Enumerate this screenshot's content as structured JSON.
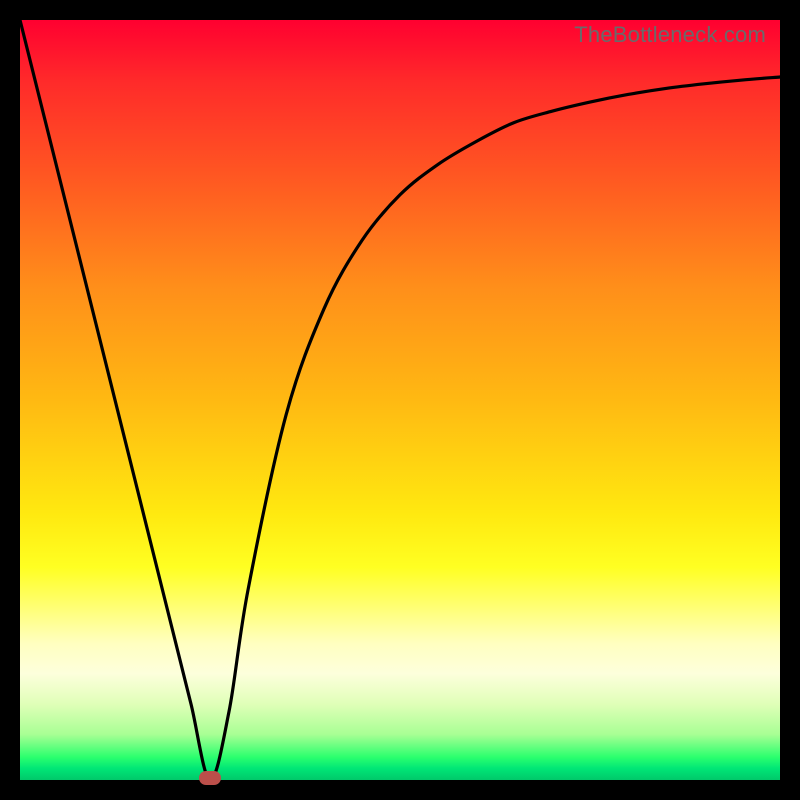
{
  "watermark": "TheBottleneck.com",
  "chart_data": {
    "type": "line",
    "title": "",
    "xlabel": "",
    "ylabel": "",
    "xlim": [
      0,
      100
    ],
    "ylim": [
      0,
      100
    ],
    "series": [
      {
        "name": "bottleneck-curve",
        "x": [
          0,
          5,
          10,
          15,
          20,
          22.5,
          25,
          27.5,
          30,
          35,
          40,
          45,
          50,
          55,
          60,
          65,
          70,
          75,
          80,
          85,
          90,
          95,
          100
        ],
        "values": [
          100,
          80,
          60,
          40,
          20,
          10,
          0,
          9,
          25,
          48,
          62,
          71,
          77,
          81,
          84,
          86.5,
          88,
          89.2,
          90.2,
          91,
          91.6,
          92.1,
          92.5
        ]
      }
    ],
    "marker": {
      "x": 25,
      "y": 0,
      "color": "#bb4f4a"
    },
    "background_gradient": {
      "top": "#ff0030",
      "mid": "#ffe910",
      "bottom": "#00c86a"
    }
  }
}
